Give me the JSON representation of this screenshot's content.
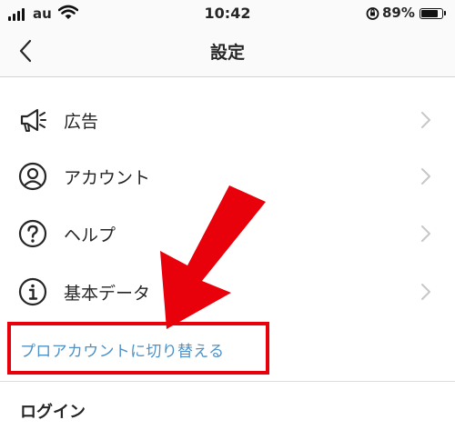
{
  "status_bar": {
    "carrier": "au",
    "time": "10:42",
    "battery_percent": "89%",
    "battery_level": 0.89
  },
  "header": {
    "title": "設定",
    "back_icon": "chevron-left-icon"
  },
  "menu": {
    "items": [
      {
        "label": "広告",
        "icon": "megaphone-icon"
      },
      {
        "label": "アカウント",
        "icon": "user-circle-icon"
      },
      {
        "label": "ヘルプ",
        "icon": "help-circle-icon"
      },
      {
        "label": "基本データ",
        "icon": "info-circle-icon"
      }
    ],
    "pro_account_link": "プロアカウントに切り替える"
  },
  "sections": {
    "login_header": "ログイン"
  },
  "annotation": {
    "highlight_color": "#e8000b",
    "arrow_color": "#e8000b"
  },
  "colors": {
    "link": "#4d91c6"
  }
}
